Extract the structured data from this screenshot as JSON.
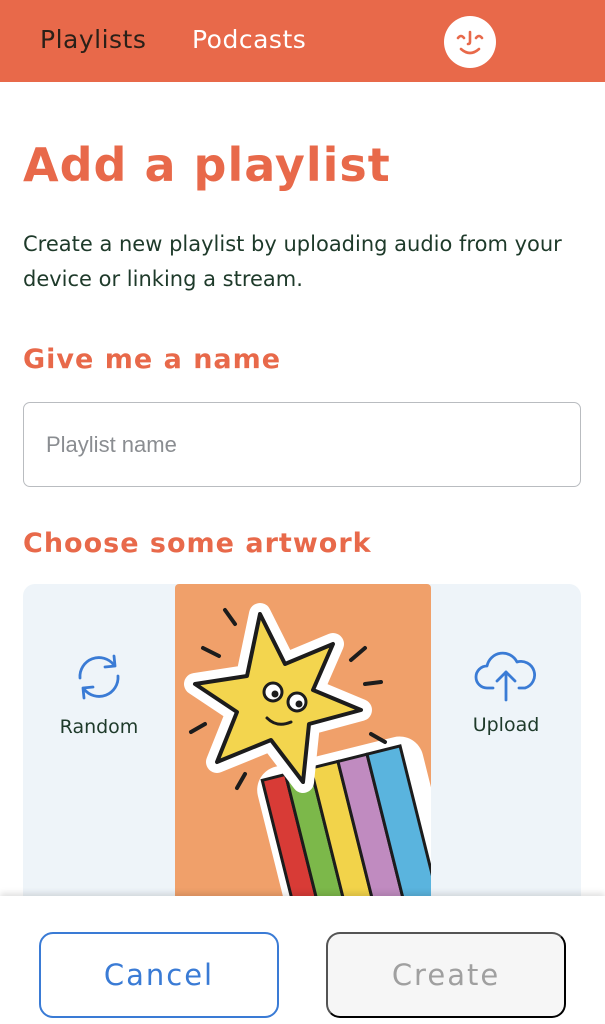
{
  "nav": {
    "tabs": [
      {
        "label": "Playlists",
        "active": true
      },
      {
        "label": "Podcasts",
        "active": false
      }
    ],
    "avatar_icon": "smiley-face-icon"
  },
  "page": {
    "title": "Add a playlist",
    "intro": "Create a new playlist by uploading audio from your device or linking a stream."
  },
  "name_section": {
    "heading": "Give me a name",
    "input_placeholder": "Playlist name",
    "input_value": ""
  },
  "artwork_section": {
    "heading": "Choose some artwork",
    "random_label": "Random",
    "random_icon": "refresh-icon",
    "upload_label": "Upload",
    "upload_icon": "cloud-upload-icon",
    "preview": "shooting-star-rainbow"
  },
  "actions": {
    "cancel_label": "Cancel",
    "create_label": "Create"
  },
  "colors": {
    "brand": "#e8694a",
    "accent_blue": "#3a7bd5",
    "artwork_bg": "#f0a06a"
  }
}
